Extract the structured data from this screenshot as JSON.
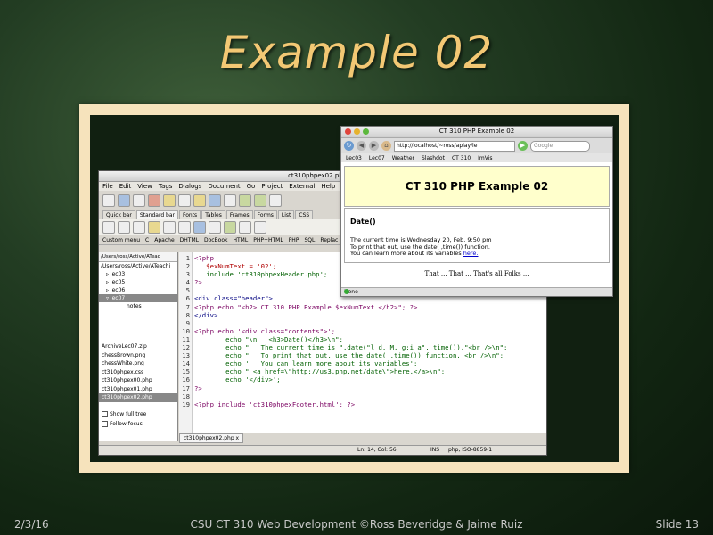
{
  "slide": {
    "title": "Example 02",
    "footer_left": "2/3/16",
    "footer_center": "CSU CT 310 Web Development ©Ross Beveridge & Jaime Ruiz",
    "footer_right": "Slide 13"
  },
  "editor": {
    "title": "ct310phpex02.php - B",
    "menu": [
      "File",
      "Edit",
      "View",
      "Tags",
      "Dialogs",
      "Document",
      "Go",
      "Project",
      "External",
      "Help"
    ],
    "tabs": [
      "Quick bar",
      "Standard bar",
      "Fonts",
      "Tables",
      "Frames",
      "Forms",
      "List",
      "CSS"
    ],
    "custom_row": [
      "Custom menu",
      "C",
      "Apache",
      "DHTML",
      "DocBook",
      "HTML",
      "PHP+HTML",
      "PHP",
      "SQL",
      "Replac"
    ],
    "sidebar_path": "/Users/ross/Active/ATeac",
    "tree": [
      "/Users/ross/Active/ATeachi",
      "lec03",
      "lec05",
      "lec06",
      "lec07",
      "_notes"
    ],
    "files": [
      "ArchiveLec07.zip",
      "chessBrown.png",
      "chessWhite.png",
      "ct310phpex.css",
      "ct310phpex00.php",
      "ct310phpex01.php",
      "ct310phpex02.php"
    ],
    "show_full_tree": "Show full tree",
    "follow_focus": "Follow focus",
    "code_lines": [
      "<?php",
      "   $exNumText = '02';",
      "   include 'ct310phpexHeader.php';",
      "?>",
      "",
      "<div class=\"header\">",
      "<?php echo \"<h2> CT 310 PHP Example $exNumText </h2>\"; ?>",
      "</div>",
      "",
      "<?php echo '<div class=\"contents\">';",
      "        echo \"\\n   <h3>Date()</h3>\\n\";",
      "        echo \"   The current time is \".date(\"l d, M. g:i a\", time()).\"<br />\\n\";",
      "        echo \"   To print that out, use the date( ,time()) function. <br />\\n\";",
      "        echo '   You can learn more about its variables';",
      "        echo \" <a href=\\\"http://us3.php.net/date\\\">here.</a>\\n\";",
      "        echo '</div>';",
      "?>",
      "",
      "<?php include 'ct310phpexFooter.html'; ?>"
    ],
    "file_tab": "ct310phpex02.php",
    "status_pos": "Ln: 14, Col: 56",
    "status_ins": "INS",
    "status_enc": "php, ISO-8859-1"
  },
  "browser": {
    "title": "CT 310 PHP Example 02",
    "url": "http://localhost/~ross/aplay/le",
    "search_placeholder": "Google",
    "bookmarks": [
      "Lec03",
      "Lec07",
      "Weather",
      "Slashdot",
      "CT 310",
      "ImVis"
    ],
    "page_heading": "CT 310 PHP Example 02",
    "section_heading": "Date()",
    "line1": "The current time is Wednesday 20, Feb. 9:50 pm",
    "line2": "To print that out, use the date( ,time()) function.",
    "line3": "You can learn more about its variables",
    "link": "here.",
    "footer": "That ... That ... That's all Folks ...",
    "status": "Done"
  }
}
